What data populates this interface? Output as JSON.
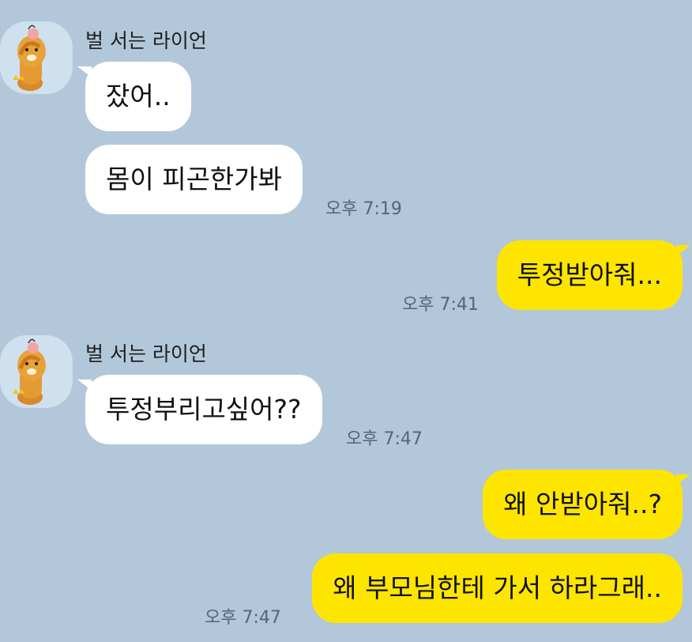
{
  "colors": {
    "background": "#b2c7da",
    "incoming": "#ffffff",
    "outgoing": "#fee500",
    "time": "#56657a"
  },
  "messages": {
    "m1": {
      "sender": "벌 서는 라이언",
      "text": "잤어.."
    },
    "m2": {
      "text": "몸이 피곤한가봐",
      "time": "오후 7:19"
    },
    "m3": {
      "text": "투정받아줘...",
      "time": "오후 7:41"
    },
    "m4": {
      "sender": "벌 서는 라이언",
      "text": "투정부리고싶어??",
      "time": "오후 7:47"
    },
    "m5": {
      "text": "왜 안받아줘..?"
    },
    "m6": {
      "text": "왜 부모님한테 가서 하라그래..",
      "time": "오후 7:47"
    }
  }
}
